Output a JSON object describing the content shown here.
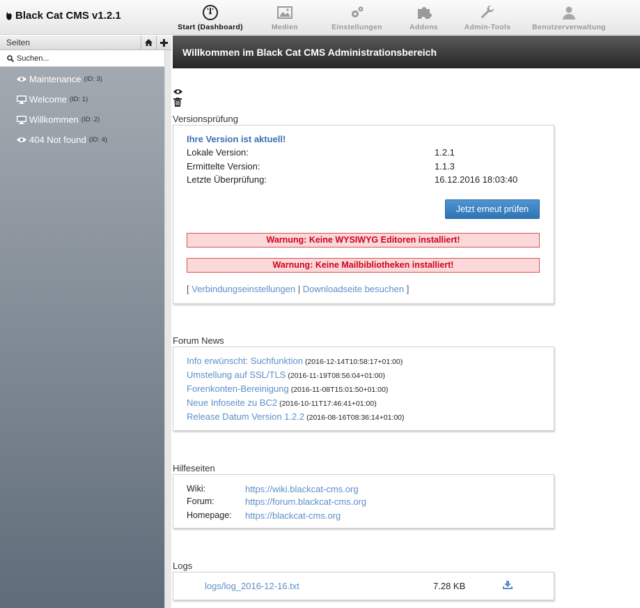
{
  "app": {
    "title": "Black Cat CMS v1.2.1"
  },
  "nav": [
    {
      "label": "Start (Dashboard)",
      "icon": "dashboard-icon",
      "active": true
    },
    {
      "label": "Medien",
      "icon": "image-icon"
    },
    {
      "label": "Einstellungen",
      "icon": "gears-icon"
    },
    {
      "label": "Addons",
      "icon": "puzzle-icon"
    },
    {
      "label": "Admin-Tools",
      "icon": "wrench-icon"
    },
    {
      "label": "Benutzerverwaltung",
      "icon": "user-icon"
    }
  ],
  "sidebar": {
    "title": "Seiten",
    "search_placeholder": "Suchen...",
    "pages": [
      {
        "name": "Maintenance",
        "id": "(ID: 3)",
        "icon": "eye-icon"
      },
      {
        "name": "Welcome",
        "id": "(ID: 1)",
        "icon": "monitor-icon"
      },
      {
        "name": "Willkommen",
        "id": "(ID: 2)",
        "icon": "monitor-icon"
      },
      {
        "name": "404 Not found",
        "id": "(ID: 4)",
        "icon": "eye-icon"
      }
    ]
  },
  "main": {
    "welcome": "Willkommen im Black Cat CMS Administrationsbereich",
    "version": {
      "title": "Versionsprüfung",
      "status": "Ihre Version ist aktuell!",
      "rows": [
        {
          "label": "Lokale Version:",
          "value": "1.2.1"
        },
        {
          "label": "Ermittelte Version:",
          "value": "1.1.3"
        },
        {
          "label": "Letzte Überprüfung:",
          "value": "16.12.2016 18:03:40"
        }
      ],
      "button": "Jetzt erneut prüfen",
      "warnings": [
        "Warnung: Keine WYSIWYG Editoren installiert!",
        "Warnung: Keine Mailbibliotheken installiert!"
      ],
      "links": {
        "open": "[",
        "connection": "Verbindungseinstellungen",
        "sep": "|",
        "download": "Downloadseite besuchen",
        "close": "]"
      }
    },
    "news": {
      "title": "Forum News",
      "items": [
        {
          "title": "Info erwünscht: Suchfunktion",
          "date": "(2016-12-14T10:58:17+01:00)"
        },
        {
          "title": "Umstellung auf SSL/TLS",
          "date": "(2016-11-19T08:56:04+01:00)"
        },
        {
          "title": "Forenkonten-Bereinigung",
          "date": "(2016-11-08T15:01:50+01:00)"
        },
        {
          "title": "Neue Infoseite zu BC2",
          "date": "(2016-10-11T17:46:41+01:00)"
        },
        {
          "title": "Release Datum Version 1.2.2",
          "date": "(2016-08-16T08:36:14+01:00)"
        }
      ]
    },
    "help": {
      "title": "Hilfeseiten",
      "rows": [
        {
          "label": "Wiki:",
          "url": "https://wiki.blackcat-cms.org"
        },
        {
          "label": "Forum:",
          "url": "https://forum.blackcat-cms.org"
        },
        {
          "label": "Homepage:",
          "url": "https://blackcat-cms.org"
        }
      ]
    },
    "logs": {
      "title": "Logs",
      "file": "logs/log_2016-12-16.txt",
      "size": "7.28 KB"
    }
  },
  "colors": {
    "link": "#5b8fc9",
    "status": "#3b6fb6",
    "warning": "#d0021b",
    "button": "#3a80c2"
  }
}
